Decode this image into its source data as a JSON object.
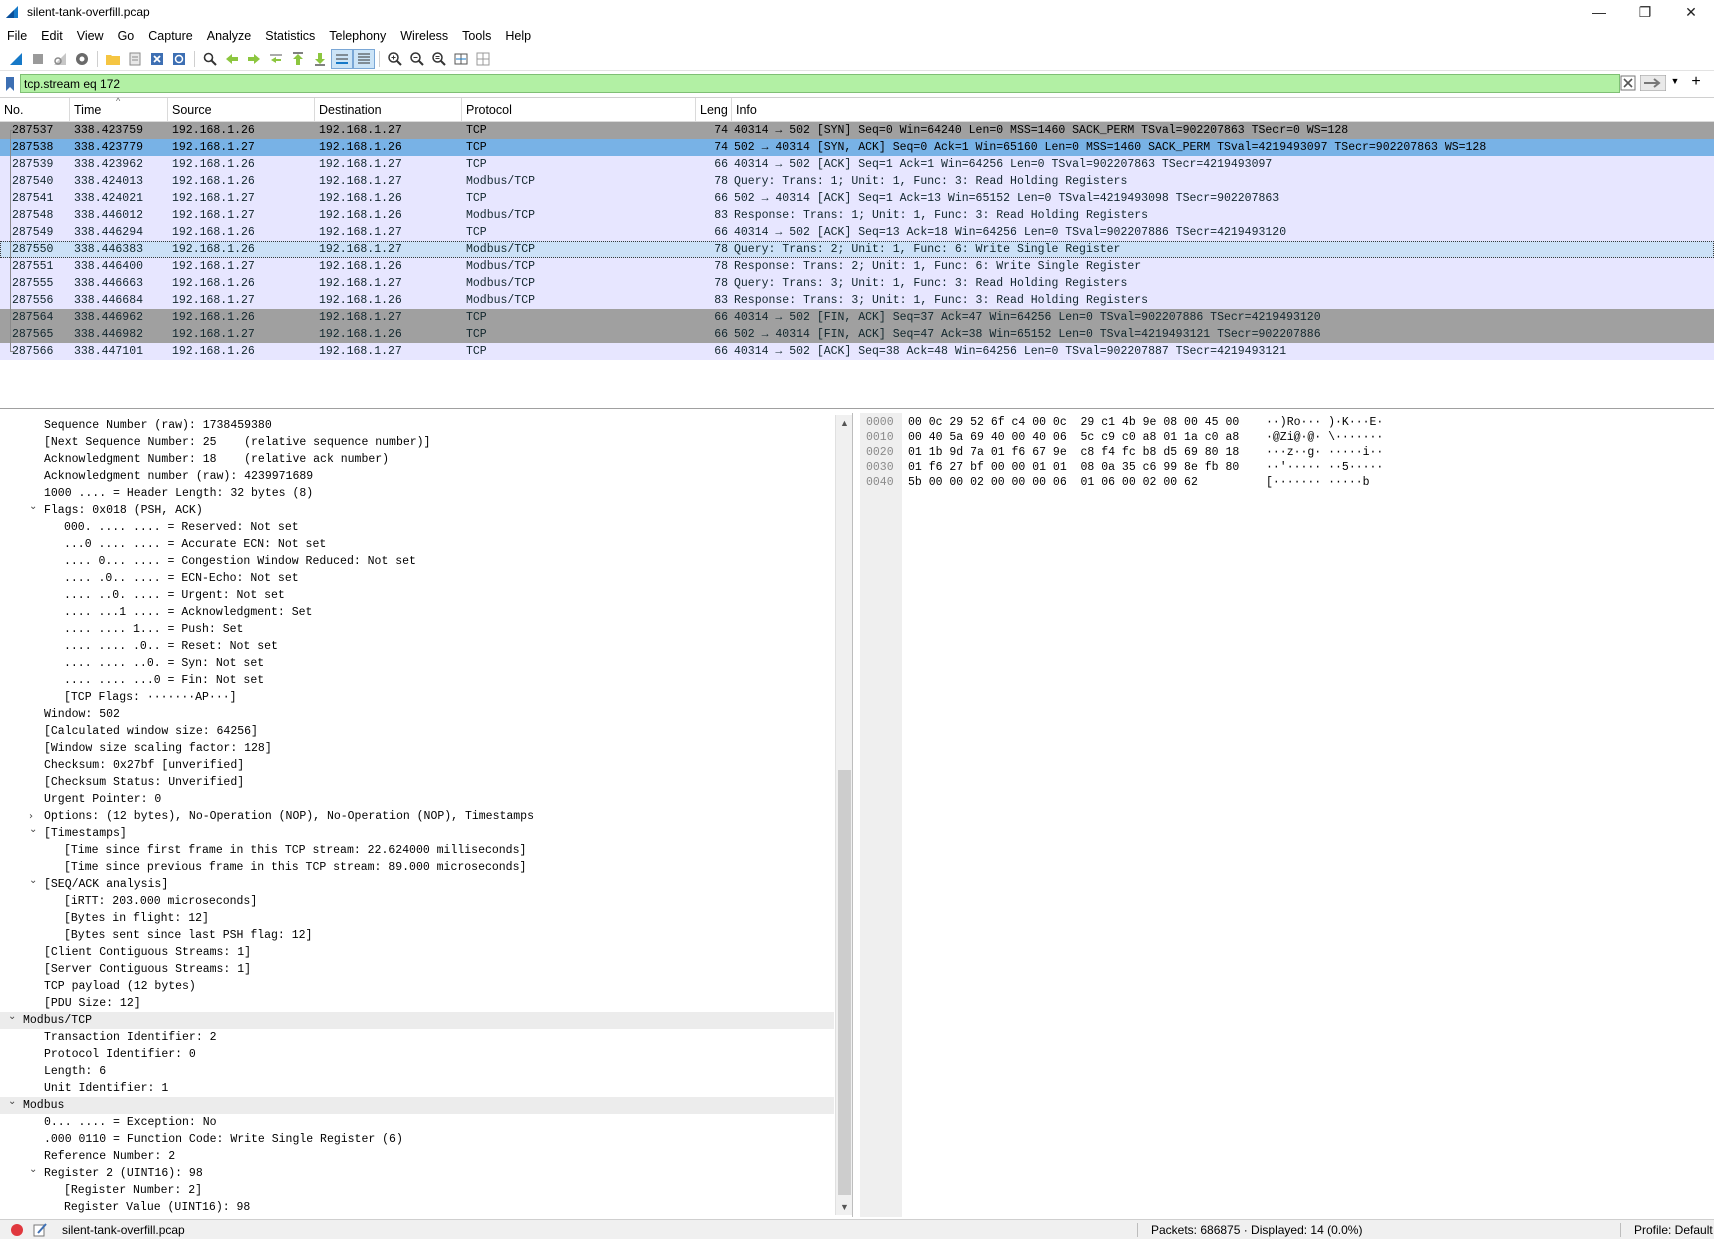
{
  "window": {
    "title": "silent-tank-overfill.pcap"
  },
  "menu": [
    "File",
    "Edit",
    "View",
    "Go",
    "Capture",
    "Analyze",
    "Statistics",
    "Telephony",
    "Wireless",
    "Tools",
    "Help"
  ],
  "filter": {
    "value": "tcp.stream eq 172"
  },
  "columns": [
    "No.",
    "Time",
    "Source",
    "Destination",
    "Protocol",
    "Leng",
    "Info"
  ],
  "packets": [
    {
      "no": "287537",
      "time": "338.423759",
      "src": "192.168.1.26",
      "dst": "192.168.1.27",
      "proto": "TCP",
      "len": "74",
      "info": "40314 → 502 [SYN] Seq=0 Win=64240 Len=0 MSS=1460 SACK_PERM TSval=902207863 TSecr=0 WS=128",
      "bg": "#a0a0a0",
      "fg": "#000000"
    },
    {
      "no": "287538",
      "time": "338.423779",
      "src": "192.168.1.27",
      "dst": "192.168.1.26",
      "proto": "TCP",
      "len": "74",
      "info": "502 → 40314 [SYN, ACK] Seq=0 Ack=1 Win=65160 Len=0 MSS=1460 SACK_PERM TSval=4219493097 TSecr=902207863 WS=128",
      "bg": "#78b2e6",
      "fg": "#000000"
    },
    {
      "no": "287539",
      "time": "338.423962",
      "src": "192.168.1.26",
      "dst": "192.168.1.27",
      "proto": "TCP",
      "len": "66",
      "info": "40314 → 502 [ACK] Seq=1 Ack=1 Win=64256 Len=0 TSval=902207863 TSecr=4219493097",
      "bg": "#e7e6ff",
      "fg": "#12272e"
    },
    {
      "no": "287540",
      "time": "338.424013",
      "src": "192.168.1.26",
      "dst": "192.168.1.27",
      "proto": "Modbus/TCP",
      "len": "78",
      "info": "   Query: Trans:     1; Unit:   1, Func:   3: Read Holding Registers",
      "bg": "#e7e6ff",
      "fg": "#12272e"
    },
    {
      "no": "287541",
      "time": "338.424021",
      "src": "192.168.1.27",
      "dst": "192.168.1.26",
      "proto": "TCP",
      "len": "66",
      "info": "502 → 40314 [ACK] Seq=1 Ack=13 Win=65152 Len=0 TSval=4219493098 TSecr=902207863",
      "bg": "#e7e6ff",
      "fg": "#12272e"
    },
    {
      "no": "287548",
      "time": "338.446012",
      "src": "192.168.1.27",
      "dst": "192.168.1.26",
      "proto": "Modbus/TCP",
      "len": "83",
      "info": "Response: Trans:     1; Unit:   1, Func:   3: Read Holding Registers",
      "bg": "#e7e6ff",
      "fg": "#12272e"
    },
    {
      "no": "287549",
      "time": "338.446294",
      "src": "192.168.1.26",
      "dst": "192.168.1.27",
      "proto": "TCP",
      "len": "66",
      "info": "40314 → 502 [ACK] Seq=13 Ack=18 Win=64256 Len=0 TSval=902207886 TSecr=4219493120",
      "bg": "#e7e6ff",
      "fg": "#12272e"
    },
    {
      "no": "287550",
      "time": "338.446383",
      "src": "192.168.1.26",
      "dst": "192.168.1.27",
      "proto": "Modbus/TCP",
      "len": "78",
      "info": "   Query: Trans:     2; Unit:   1, Func:   6: Write Single Register",
      "bg": "#cce1f7",
      "fg": "#12272e",
      "selected": true
    },
    {
      "no": "287551",
      "time": "338.446400",
      "src": "192.168.1.27",
      "dst": "192.168.1.26",
      "proto": "Modbus/TCP",
      "len": "78",
      "info": "Response: Trans:     2; Unit:   1, Func:   6: Write Single Register",
      "bg": "#e7e6ff",
      "fg": "#12272e"
    },
    {
      "no": "287555",
      "time": "338.446663",
      "src": "192.168.1.26",
      "dst": "192.168.1.27",
      "proto": "Modbus/TCP",
      "len": "78",
      "info": "   Query: Trans:     3; Unit:   1, Func:   3: Read Holding Registers",
      "bg": "#e7e6ff",
      "fg": "#12272e"
    },
    {
      "no": "287556",
      "time": "338.446684",
      "src": "192.168.1.27",
      "dst": "192.168.1.26",
      "proto": "Modbus/TCP",
      "len": "83",
      "info": "Response: Trans:     3; Unit:   1, Func:   3: Read Holding Registers",
      "bg": "#e7e6ff",
      "fg": "#12272e"
    },
    {
      "no": "287564",
      "time": "338.446962",
      "src": "192.168.1.26",
      "dst": "192.168.1.27",
      "proto": "TCP",
      "len": "66",
      "info": "40314 → 502 [FIN, ACK] Seq=37 Ack=47 Win=64256 Len=0 TSval=902207886 TSecr=4219493120",
      "bg": "#a0a0a0",
      "fg": "#12272e"
    },
    {
      "no": "287565",
      "time": "338.446982",
      "src": "192.168.1.27",
      "dst": "192.168.1.26",
      "proto": "TCP",
      "len": "66",
      "info": "502 → 40314 [FIN, ACK] Seq=47 Ack=38 Win=65152 Len=0 TSval=4219493121 TSecr=902207886",
      "bg": "#a0a0a0",
      "fg": "#12272e"
    },
    {
      "no": "287566",
      "time": "338.447101",
      "src": "192.168.1.26",
      "dst": "192.168.1.27",
      "proto": "TCP",
      "len": "66",
      "info": "40314 → 502 [ACK] Seq=38 Ack=48 Win=64256 Len=0 TSval=902207887 TSecr=4219493121",
      "bg": "#e7e6ff",
      "fg": "#12272e"
    }
  ],
  "details": [
    {
      "text": "Sequence Number (raw): 1738459380",
      "indent": 1
    },
    {
      "text": "[Next Sequence Number: 25    (relative sequence number)]",
      "indent": 1
    },
    {
      "text": "Acknowledgment Number: 18    (relative ack number)",
      "indent": 1
    },
    {
      "text": "Acknowledgment number (raw): 4239971689",
      "indent": 1
    },
    {
      "text": "1000 .... = Header Length: 32 bytes (8)",
      "indent": 1
    },
    {
      "text": "Flags: 0x018 (PSH, ACK)",
      "indent": 1,
      "chev": "down"
    },
    {
      "text": "000. .... .... = Reserved: Not set",
      "indent": 2
    },
    {
      "text": "...0 .... .... = Accurate ECN: Not set",
      "indent": 2
    },
    {
      "text": ".... 0... .... = Congestion Window Reduced: Not set",
      "indent": 2
    },
    {
      "text": ".... .0.. .... = ECN-Echo: Not set",
      "indent": 2
    },
    {
      "text": ".... ..0. .... = Urgent: Not set",
      "indent": 2
    },
    {
      "text": ".... ...1 .... = Acknowledgment: Set",
      "indent": 2
    },
    {
      "text": ".... .... 1... = Push: Set",
      "indent": 2
    },
    {
      "text": ".... .... .0.. = Reset: Not set",
      "indent": 2
    },
    {
      "text": ".... .... ..0. = Syn: Not set",
      "indent": 2
    },
    {
      "text": ".... .... ...0 = Fin: Not set",
      "indent": 2
    },
    {
      "text": "[TCP Flags: ·······AP···]",
      "indent": 2
    },
    {
      "text": "Window: 502",
      "indent": 1
    },
    {
      "text": "[Calculated window size: 64256]",
      "indent": 1
    },
    {
      "text": "[Window size scaling factor: 128]",
      "indent": 1
    },
    {
      "text": "Checksum: 0x27bf [unverified]",
      "indent": 1
    },
    {
      "text": "[Checksum Status: Unverified]",
      "indent": 1
    },
    {
      "text": "Urgent Pointer: 0",
      "indent": 1
    },
    {
      "text": "Options: (12 bytes), No-Operation (NOP), No-Operation (NOP), Timestamps",
      "indent": 1,
      "chev": "right"
    },
    {
      "text": "[Timestamps]",
      "indent": 1,
      "chev": "down"
    },
    {
      "text": "[Time since first frame in this TCP stream: 22.624000 milliseconds]",
      "indent": 2
    },
    {
      "text": "[Time since previous frame in this TCP stream: 89.000 microseconds]",
      "indent": 2
    },
    {
      "text": "[SEQ/ACK analysis]",
      "indent": 1,
      "chev": "down"
    },
    {
      "text": "[iRTT: 203.000 microseconds]",
      "indent": 2
    },
    {
      "text": "[Bytes in flight: 12]",
      "indent": 2
    },
    {
      "text": "[Bytes sent since last PSH flag: 12]",
      "indent": 2
    },
    {
      "text": "[Client Contiguous Streams: 1]",
      "indent": 1
    },
    {
      "text": "[Server Contiguous Streams: 1]",
      "indent": 1
    },
    {
      "text": "TCP payload (12 bytes)",
      "indent": 1
    },
    {
      "text": "[PDU Size: 12]",
      "indent": 1
    },
    {
      "text": "Modbus/TCP",
      "indent": 0,
      "chev": "down",
      "hl": true
    },
    {
      "text": "Transaction Identifier: 2",
      "indent": 1
    },
    {
      "text": "Protocol Identifier: 0",
      "indent": 1
    },
    {
      "text": "Length: 6",
      "indent": 1
    },
    {
      "text": "Unit Identifier: 1",
      "indent": 1
    },
    {
      "text": "Modbus",
      "indent": 0,
      "chev": "down",
      "hl": true
    },
    {
      "text": "0... .... = Exception: No",
      "indent": 1
    },
    {
      "text": ".000 0110 = Function Code: Write Single Register (6)",
      "indent": 1
    },
    {
      "text": "Reference Number: 2",
      "indent": 1
    },
    {
      "text": "Register 2 (UINT16): 98",
      "indent": 1,
      "chev": "down"
    },
    {
      "text": "[Register Number: 2]",
      "indent": 2
    },
    {
      "text": "Register Value (UINT16): 98",
      "indent": 2
    }
  ],
  "bytes": [
    {
      "off": "0000",
      "hex": "00 0c 29 52 6f c4 00 0c  29 c1 4b 9e 08 00 45 00",
      "ascii": "··)Ro··· )·K···E·"
    },
    {
      "off": "0010",
      "hex": "00 40 5a 69 40 00 40 06  5c c9 c0 a8 01 1a c0 a8",
      "ascii": "·@Zi@·@· \\·······"
    },
    {
      "off": "0020",
      "hex": "01 1b 9d 7a 01 f6 67 9e  c8 f4 fc b8 d5 69 80 18",
      "ascii": "···z··g· ·····i··"
    },
    {
      "off": "0030",
      "hex": "01 f6 27 bf 00 00 01 01  08 0a 35 c6 99 8e fb 80",
      "ascii": "··'····· ··5·····"
    },
    {
      "off": "0040",
      "hex": "5b 00 00 02 00 00 00 06  01 06 00 02 00 62",
      "ascii": "[······· ·····b"
    }
  ],
  "status": {
    "file": "silent-tank-overfill.pcap",
    "packets": "Packets: 686875 · Displayed: 14 (0.0%)",
    "profile": "Profile: Default"
  }
}
